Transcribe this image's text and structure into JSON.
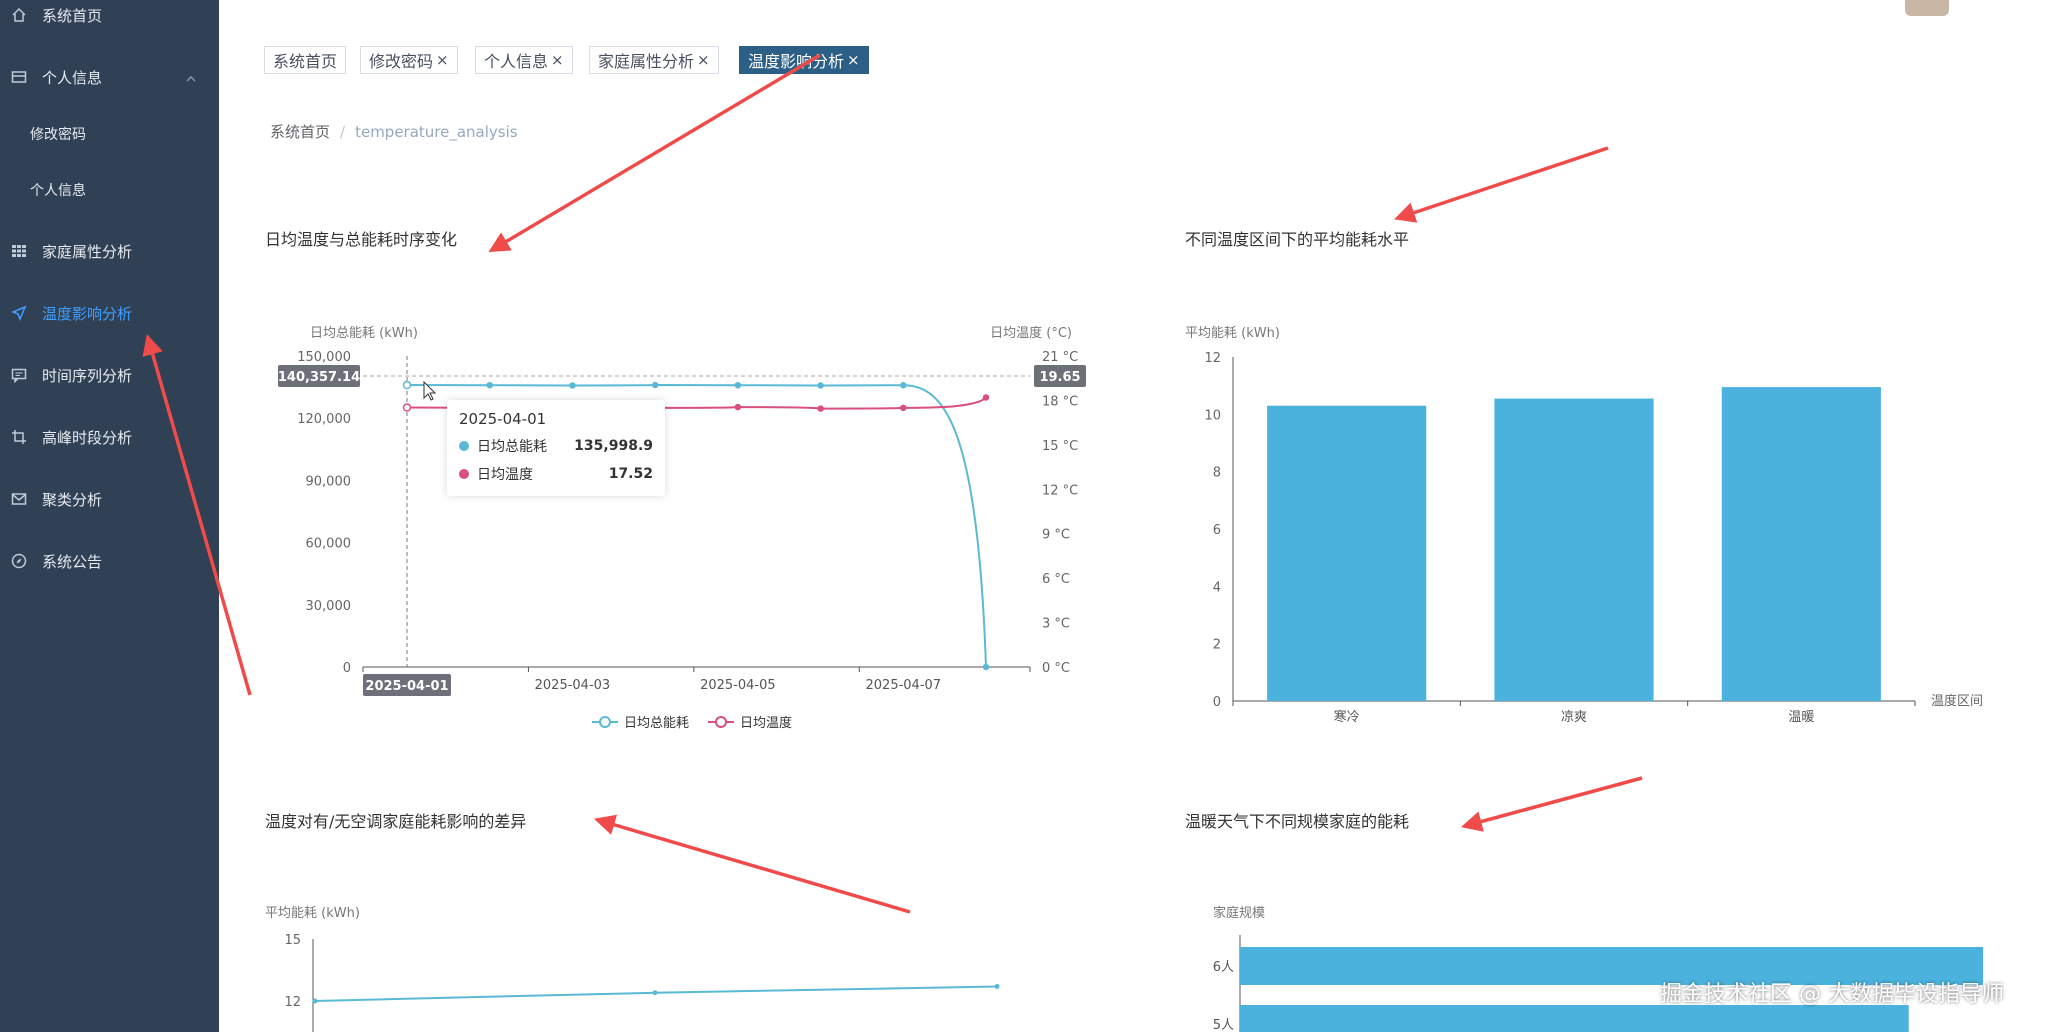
{
  "sidebar": {
    "items": [
      {
        "label": "系统首页",
        "icon": "home-icon"
      },
      {
        "label": "个人信息",
        "icon": "profile-icon"
      },
      {
        "label": "修改密码"
      },
      {
        "label": "个人信息"
      },
      {
        "label": "家庭属性分析",
        "icon": "grid-icon"
      },
      {
        "label": "温度影响分析",
        "icon": "send-icon"
      },
      {
        "label": "时间序列分析",
        "icon": "chat-icon"
      },
      {
        "label": "高峰时段分析",
        "icon": "crop-icon"
      },
      {
        "label": "聚类分析",
        "icon": "mail-icon"
      },
      {
        "label": "系统公告",
        "icon": "compass-icon"
      }
    ]
  },
  "tabs": [
    {
      "label": "系统首页"
    },
    {
      "label": "修改密码",
      "close": "×"
    },
    {
      "label": "个人信息",
      "close": "×"
    },
    {
      "label": "家庭属性分析",
      "close": "×"
    },
    {
      "label": "温度影响分析",
      "close": "×"
    }
  ],
  "breadcrumb": {
    "home": "系统首页",
    "sep": "/",
    "current": "temperature_analysis"
  },
  "colors": {
    "sidebar_bg": "#304156",
    "active": "#409eff",
    "tab_active": "#2b5f86",
    "series1": "#5ab9d4",
    "series2": "#d9507a",
    "bar": "#4ab2dc"
  },
  "charts": {
    "c1": {
      "title": "日均温度与总能耗时序变化"
    },
    "c2": {
      "title": "不同温度区间下的平均能耗水平"
    },
    "c3": {
      "title": "温度对有/无空调家庭能耗影响的差异"
    },
    "c4": {
      "title": "温暖天气下不同规模家庭的能耗"
    }
  },
  "chart_data": [
    {
      "type": "line",
      "title": "日均温度与总能耗时序变化",
      "ylabel": "日均总能耗 (kWh)",
      "y2label": "日均温度 (°C)",
      "ylim": [
        0,
        150000
      ],
      "y2lim": [
        0,
        21
      ],
      "yticks": [
        "150,000",
        "120,000",
        "90,000",
        "60,000",
        "30,000",
        "0"
      ],
      "y2ticks": [
        "21 °C",
        "18 °C",
        "15 °C",
        "12 °C",
        "9 °C",
        "6 °C",
        "3 °C",
        "0 °C"
      ],
      "xticks": [
        "2025-04-01",
        "2025-04-03",
        "2025-04-05",
        "2025-04-07"
      ],
      "x": [
        "2025-04-01",
        "2025-04-02",
        "2025-04-03",
        "2025-04-04",
        "2025-04-05",
        "2025-04-06",
        "2025-04-07",
        "2025-04-08"
      ],
      "series": [
        {
          "name": "日均总能耗",
          "axis": "left",
          "values": [
            135998.9,
            135900,
            135800,
            136000,
            135900,
            135800,
            135900,
            0
          ]
        },
        {
          "name": "日均温度",
          "axis": "right",
          "values": [
            17.52,
            17.5,
            17.45,
            17.5,
            17.55,
            17.45,
            17.5,
            18.2
          ]
        }
      ],
      "pointer": {
        "x_label": "2025-04-01",
        "y_label": "140,357.14",
        "y2_label": "19.65",
        "y_value": 140357.14
      },
      "tooltip": {
        "date": "2025-04-01",
        "rows": [
          {
            "name": "日均总能耗",
            "value": "135,998.9"
          },
          {
            "name": "日均温度",
            "value": "17.52"
          }
        ]
      },
      "legend": [
        "日均总能耗",
        "日均温度"
      ]
    },
    {
      "type": "bar",
      "title": "不同温度区间下的平均能耗水平",
      "ylabel": "平均能耗 (kWh)",
      "xlabel": "温度区间",
      "categories": [
        "寒冷",
        "凉爽",
        "温暖"
      ],
      "values": [
        10.3,
        10.55,
        10.95
      ],
      "ylim": [
        0,
        12
      ],
      "yticks": [
        "12",
        "10",
        "8",
        "6",
        "4",
        "2",
        "0"
      ]
    },
    {
      "type": "line",
      "title": "温度对有/无空调家庭能耗影响的差异",
      "ylabel": "平均能耗 (kWh)",
      "yticks": [
        "15",
        "12"
      ],
      "ylim": [
        9,
        15
      ],
      "values": [
        12.0,
        12.4,
        12.7
      ]
    },
    {
      "type": "bar",
      "title": "温暖天气下不同规模家庭的能耗",
      "ylabel": "家庭规模",
      "categories": [
        "6人",
        "5人"
      ],
      "values": [
        1.0,
        0.9
      ]
    }
  ],
  "watermark": "掘金技术社区 @ 大数据毕设指导师"
}
